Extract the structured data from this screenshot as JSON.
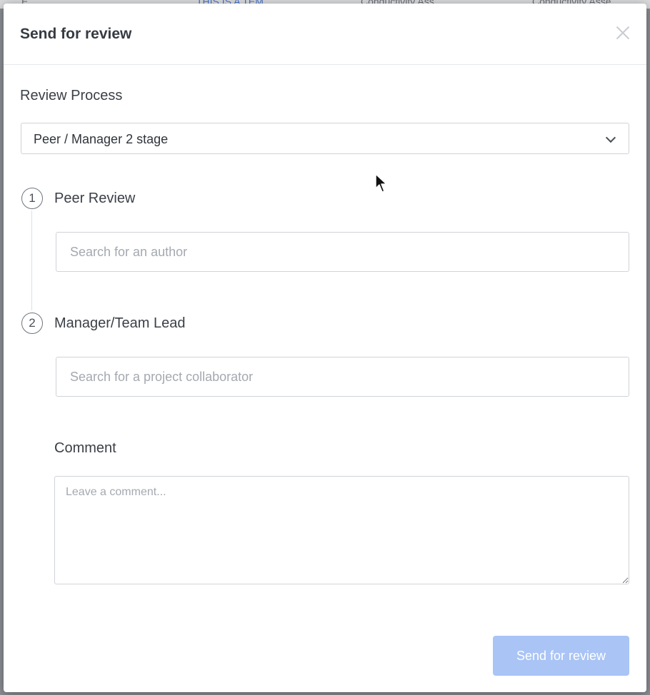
{
  "background": {
    "tabs": [
      "E...",
      "THIS IS A TEM...",
      "Conductivity Ass...",
      "Conductivity Asse..."
    ]
  },
  "modal": {
    "title": "Send for review",
    "review_process_label": "Review Process",
    "review_process_selected": "Peer / Manager 2 stage",
    "steps": [
      {
        "number": "1",
        "label": "Peer Review",
        "placeholder": "Search for an author"
      },
      {
        "number": "2",
        "label": "Manager/Team Lead",
        "placeholder": "Search for a project collaborator"
      }
    ],
    "comment_label": "Comment",
    "comment_placeholder": "Leave a comment...",
    "submit_label": "Send for review"
  },
  "colors": {
    "submit_button_disabled": "#a9c4f5",
    "title_text": "#363b42"
  },
  "icons": [
    "close-icon",
    "chevron-down-icon",
    "mouse-cursor-icon"
  ]
}
